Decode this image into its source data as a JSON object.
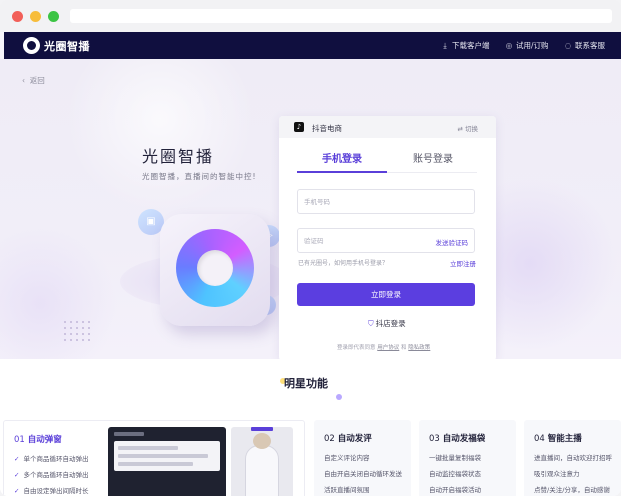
{
  "header": {
    "logo_text": "光圈智播",
    "links": [
      {
        "icon": "download-icon",
        "label": "下载客户端"
      },
      {
        "icon": "cart-icon",
        "label": "试用/订购"
      },
      {
        "icon": "chat-icon",
        "label": "联系客服"
      }
    ]
  },
  "hero": {
    "back_label": "返回",
    "title": "光圈智播",
    "subtitle": "光圈智播，直播间的智能中控!"
  },
  "login": {
    "shop_name": "抖音电商",
    "switch_label": "切换",
    "tabs": [
      {
        "label": "手机登录",
        "active": true
      },
      {
        "label": "账号登录",
        "active": false
      }
    ],
    "phone_placeholder": "手机号码",
    "code_placeholder": "验证码",
    "send_code_label": "发送验证码",
    "hint": "已有光圈号，如何用手机号登录？",
    "register_label": "立即注册",
    "login_button": "立即登录",
    "shop_login_label": "抖店登录",
    "agreement_prefix": "登录即代表同意",
    "agreement_user": "用户协议",
    "agreement_and": "和",
    "agreement_privacy": "隐私政策"
  },
  "features": {
    "title": "明星功能",
    "cards": [
      {
        "num": "01",
        "name": "自动弹窗",
        "items": [
          "单个商品循环自动弹出",
          "多个商品循环自动弹出",
          "自由设定弹出间隔时长"
        ]
      },
      {
        "num": "02",
        "name": "自动发评",
        "items": [
          "自定义评论内容",
          "自由开启关闭自动循环发送",
          "活跃直播间氛围"
        ]
      },
      {
        "num": "03",
        "name": "自动发福袋",
        "items": [
          "一键批量复制福袋",
          "自动监控福袋状态",
          "自动开启福袋活动"
        ]
      },
      {
        "num": "04",
        "name": "智能主播",
        "items": [
          "进直播间，自动欢迎打招呼",
          "吸引观众注意力",
          "点赞/关注/分享，自动感谢"
        ]
      }
    ]
  },
  "colors": {
    "nav_bg": "#100f3f",
    "accent": "#5b3ee0"
  }
}
